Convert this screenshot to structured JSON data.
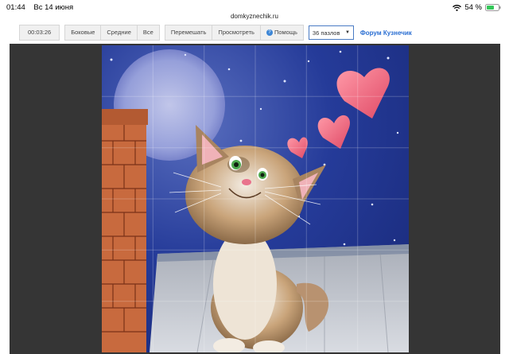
{
  "status": {
    "time": "01:44",
    "date": "Вс 14 июня",
    "battery": "54 %"
  },
  "browser": {
    "url": "domkyznechik.ru"
  },
  "toolbar": {
    "timer": "00:03:26",
    "edge_label": "Боковые",
    "middle_label": "Средние",
    "all_label": "Все",
    "shuffle_label": "Перемешать",
    "preview_label": "Просмотреть",
    "help_label": "Помощь",
    "pieces_select": "36 пазлов",
    "forum_link": "Форум Кузнечик"
  },
  "puzzle": {
    "pieces": 36,
    "rows": 6,
    "cols": 6
  }
}
